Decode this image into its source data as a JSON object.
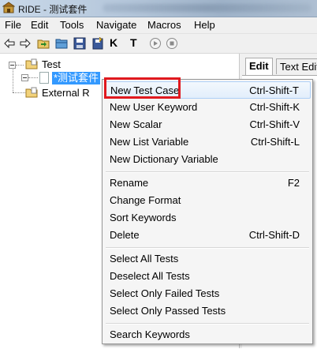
{
  "window": {
    "title": "RIDE - 测试套件"
  },
  "menubar": {
    "items": [
      "File",
      "Edit",
      "Tools",
      "Navigate",
      "Macros",
      "Help"
    ]
  },
  "toolbar": {
    "icons": [
      "back-arrow-icon",
      "forward-arrow-icon",
      "open-folder-icon",
      "open-directory-icon",
      "save-icon",
      "save-all-icon",
      "keyword-search-icon",
      "test-search-icon",
      "run-icon",
      "stop-icon"
    ],
    "keyword_glyph": "K",
    "test_glyph": "T"
  },
  "tree": {
    "root_label": "Test",
    "selected_label": "*测试套件",
    "external_label": "External R"
  },
  "right_pane": {
    "tabs": [
      "Edit",
      "Text Edit"
    ]
  },
  "context_menu": {
    "groups": [
      [
        {
          "label": "New Test Case",
          "shortcut": "Ctrl-Shift-T"
        },
        {
          "label": "New User Keyword",
          "shortcut": "Ctrl-Shift-K"
        },
        {
          "label": "New Scalar",
          "shortcut": "Ctrl-Shift-V"
        },
        {
          "label": "New List Variable",
          "shortcut": "Ctrl-Shift-L"
        },
        {
          "label": "New Dictionary Variable",
          "shortcut": ""
        }
      ],
      [
        {
          "label": "Rename",
          "shortcut": "F2"
        },
        {
          "label": "Change Format",
          "shortcut": ""
        },
        {
          "label": "Sort Keywords",
          "shortcut": ""
        },
        {
          "label": "Delete",
          "shortcut": "Ctrl-Shift-D"
        }
      ],
      [
        {
          "label": "Select All Tests",
          "shortcut": ""
        },
        {
          "label": "Deselect All Tests",
          "shortcut": ""
        },
        {
          "label": "Select Only Failed Tests",
          "shortcut": ""
        },
        {
          "label": "Select Only Passed Tests",
          "shortcut": ""
        }
      ],
      [
        {
          "label": "Search Keywords",
          "shortcut": ""
        }
      ]
    ],
    "highlighted": "New Test Case",
    "annotation_color": "#e0191f"
  }
}
